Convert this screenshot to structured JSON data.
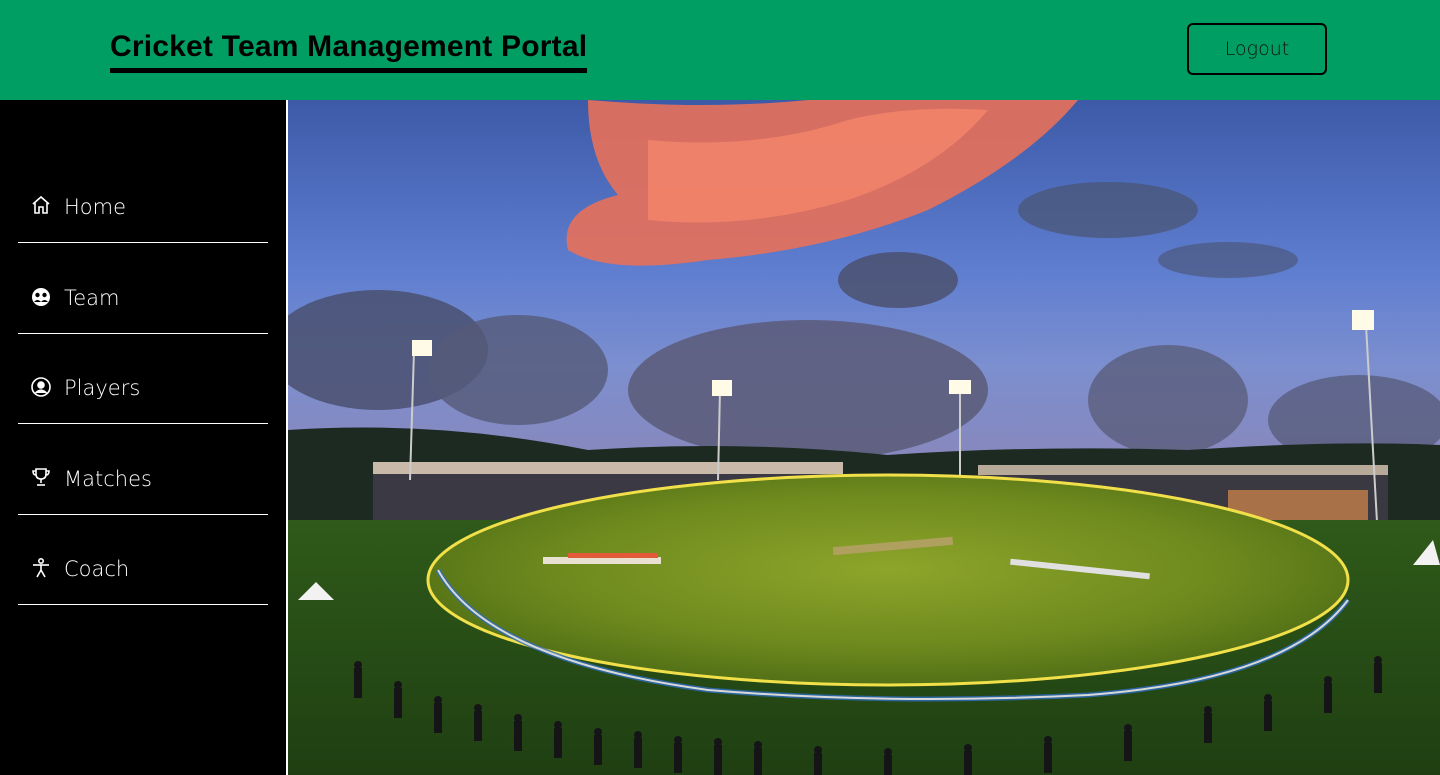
{
  "header": {
    "title": "Cricket Team Management Portal",
    "logout_label": "Logout",
    "bg_color": "#009e63"
  },
  "sidebar": {
    "items": [
      {
        "label": "Home",
        "icon": "home-icon"
      },
      {
        "label": "Team",
        "icon": "team-icon"
      },
      {
        "label": "Players",
        "icon": "player-icon"
      },
      {
        "label": "Matches",
        "icon": "trophy-icon"
      },
      {
        "label": "Coach",
        "icon": "coach-icon"
      }
    ]
  },
  "hero": {
    "image": "cricket stadium at dusk"
  }
}
